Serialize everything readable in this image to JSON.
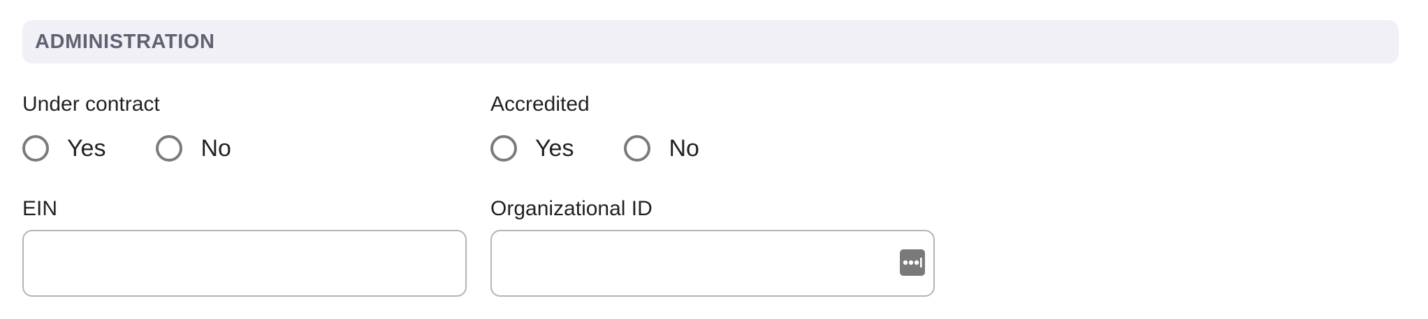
{
  "section": {
    "title": "ADMINISTRATION"
  },
  "under_contract": {
    "label": "Under contract",
    "options": [
      "Yes",
      "No"
    ],
    "selected": null
  },
  "accredited": {
    "label": "Accredited",
    "options": [
      "Yes",
      "No"
    ],
    "selected": null
  },
  "ein": {
    "label": "EIN",
    "value": "",
    "placeholder": ""
  },
  "organizational_id": {
    "label": "Organizational ID",
    "value": "",
    "placeholder": "",
    "icon": "password-manager-icon"
  }
}
